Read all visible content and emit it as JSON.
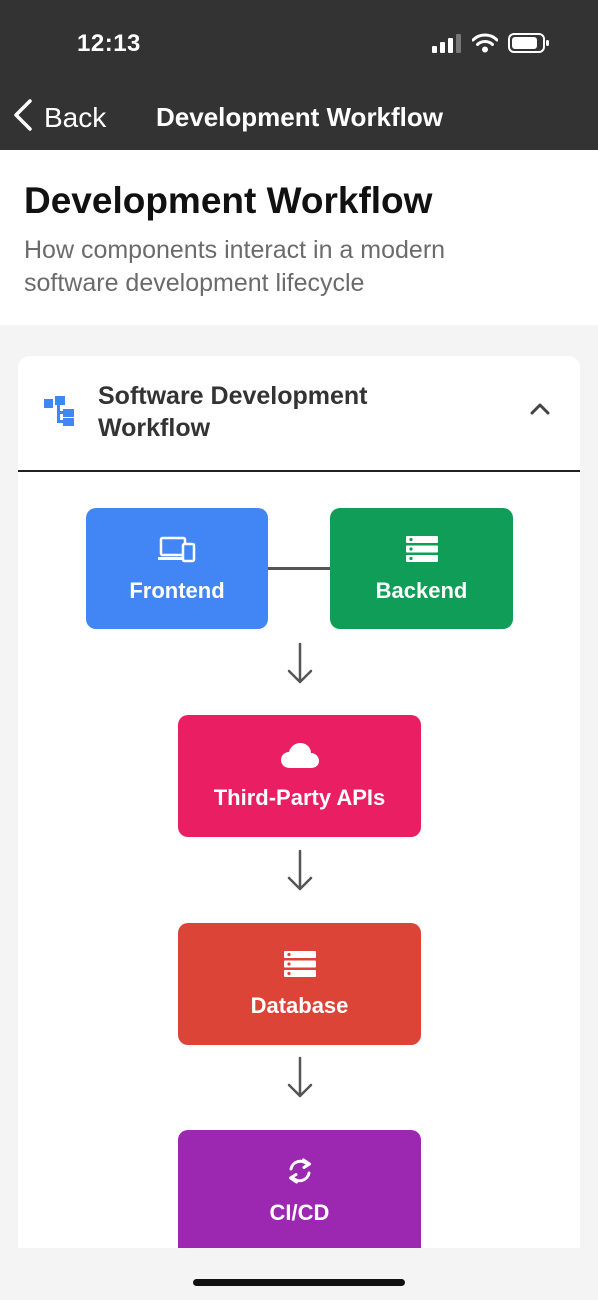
{
  "status_bar": {
    "time": "12:13"
  },
  "nav": {
    "back_label": "Back",
    "title": "Development Workflow"
  },
  "header": {
    "title": "Development Workflow",
    "subtitle": "How components interact in a modern software development lifecycle"
  },
  "card": {
    "title": "Software Development Workflow",
    "nodes": [
      {
        "label": "Frontend",
        "icon": "devices-icon",
        "color": "#4285f4"
      },
      {
        "label": "Backend",
        "icon": "server-icon",
        "color": "#0f9d58"
      },
      {
        "label": "Third-Party APIs",
        "icon": "cloud-icon",
        "color": "#e91e63"
      },
      {
        "label": "Database",
        "icon": "server-icon",
        "color": "#db4437"
      },
      {
        "label": "CI/CD",
        "icon": "sync-icon",
        "color": "#9c27b0"
      }
    ]
  },
  "colors": {
    "bar_bg": "#333333",
    "page_bg": "#f4f4f4",
    "accent_icon": "#4285f4"
  }
}
